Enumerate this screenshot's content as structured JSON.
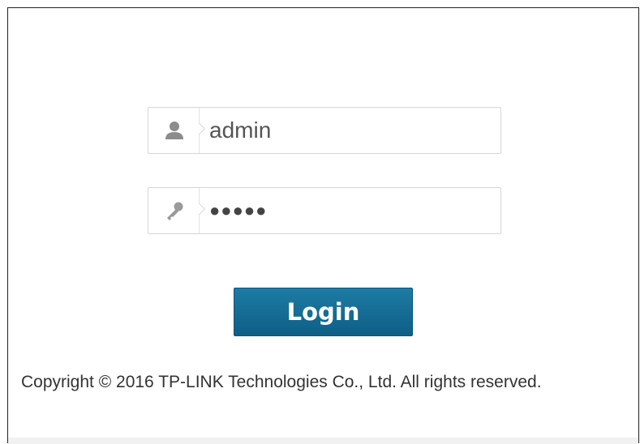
{
  "login_form": {
    "username": {
      "value": "admin",
      "icon": "user-icon"
    },
    "password": {
      "value": "●●●●●",
      "icon": "key-icon"
    },
    "login_label": "Login"
  },
  "footer": {
    "copyright": "Copyright © 2016 TP-LINK Technologies Co., Ltd. All rights reserved."
  },
  "colors": {
    "button_bg": "#13688f",
    "field_border": "#d6d6d6",
    "text": "#555555"
  }
}
